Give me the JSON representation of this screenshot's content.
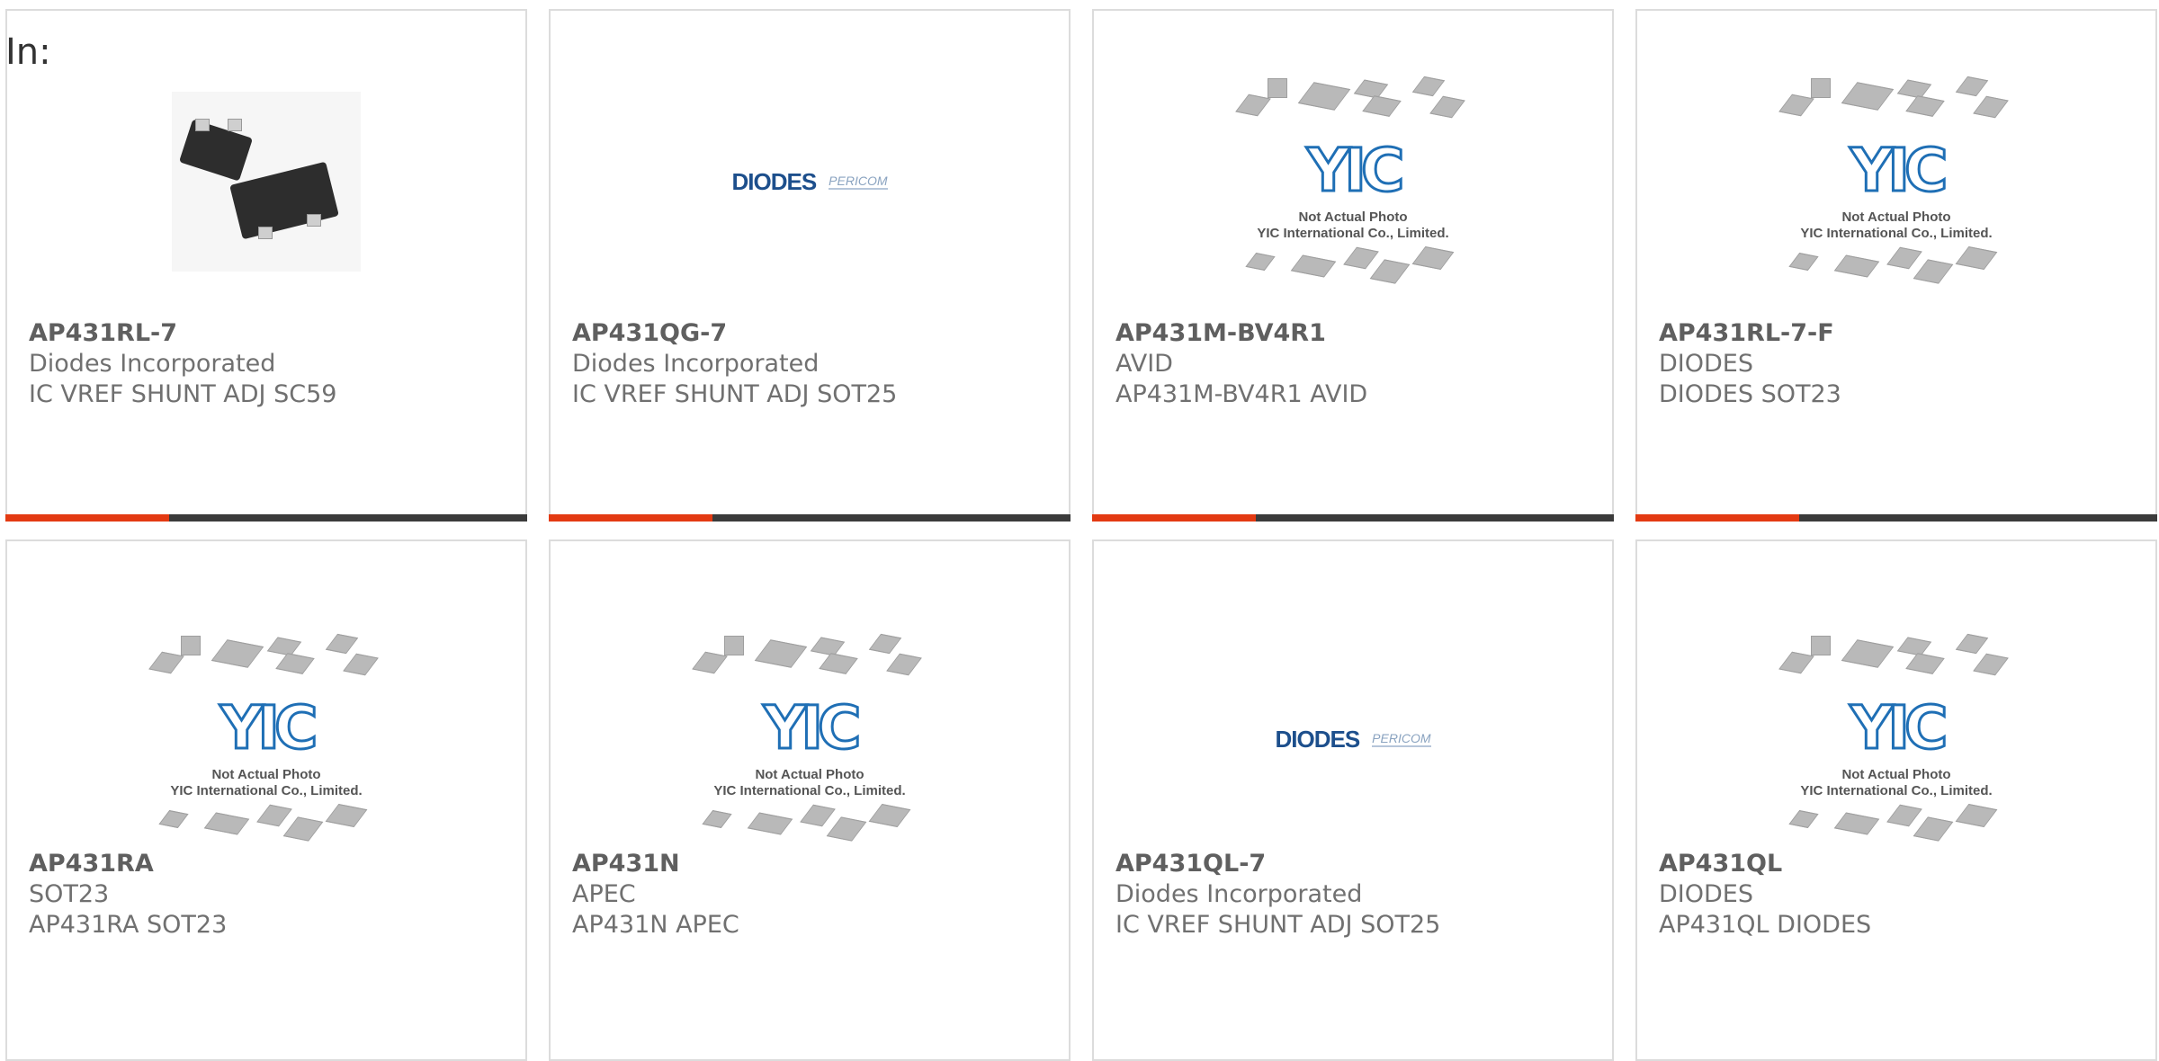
{
  "header": {
    "label": "In:"
  },
  "placeholder": {
    "line1": "Not Actual Photo",
    "line2": "YIC International Co., Limited."
  },
  "logo": {
    "diodes": "DIODES",
    "pericom": "PERICOM"
  },
  "colors": {
    "accent": "#e33a12",
    "bar": "#3b3b3b"
  },
  "products": [
    {
      "part": "AP431RL-7",
      "manufacturer": "Diodes Incorporated",
      "description": "IC VREF SHUNT ADJ SC59",
      "image": "photo"
    },
    {
      "part": "AP431QG-7",
      "manufacturer": "Diodes Incorporated",
      "description": "IC VREF SHUNT ADJ SOT25",
      "image": "diodes-logo"
    },
    {
      "part": "AP431M-BV4R1",
      "manufacturer": "AVID",
      "description": "AP431M-BV4R1 AVID",
      "image": "yic-placeholder"
    },
    {
      "part": "AP431RL-7-F",
      "manufacturer": "DIODES",
      "description": "DIODES SOT23",
      "image": "yic-placeholder"
    },
    {
      "part": "AP431RA",
      "manufacturer": "SOT23",
      "description": "AP431RA SOT23",
      "image": "yic-placeholder"
    },
    {
      "part": "AP431N",
      "manufacturer": "APEC",
      "description": "AP431N APEC",
      "image": "yic-placeholder"
    },
    {
      "part": "AP431QL-7",
      "manufacturer": "Diodes Incorporated",
      "description": "IC VREF SHUNT ADJ SOT25",
      "image": "diodes-logo"
    },
    {
      "part": "AP431QL",
      "manufacturer": "DIODES",
      "description": "AP431QL DIODES",
      "image": "yic-placeholder"
    }
  ]
}
